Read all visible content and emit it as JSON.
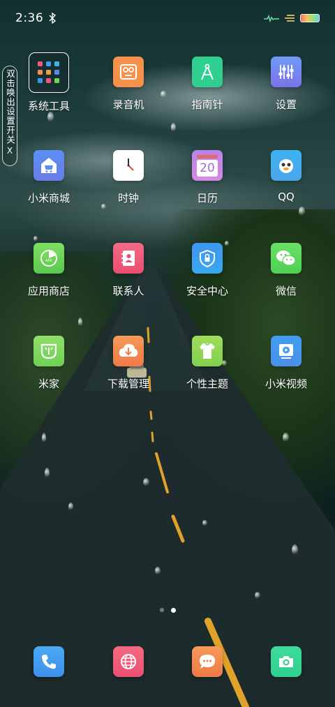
{
  "status_bar": {
    "time": "2:36",
    "bluetooth_icon": "bluetooth-icon",
    "signal_icon": "activity-icon",
    "battery_icon": "battery-icon"
  },
  "side_pill": {
    "text": "双击唤出设置开关",
    "close": "X"
  },
  "apps": [
    {
      "label": "系统工具",
      "icon": "folder-grid-icon",
      "color": "#ffffff"
    },
    {
      "label": "录音机",
      "icon": "tape-recorder-icon",
      "color": "#f5914a"
    },
    {
      "label": "指南针",
      "icon": "compass-icon",
      "color": "#2fcf8f"
    },
    {
      "label": "设置",
      "icon": "sliders-icon",
      "color": "#5c86f0"
    },
    {
      "label": "小米商城",
      "icon": "shop-icon",
      "color": "#5a8ff0"
    },
    {
      "label": "时钟",
      "icon": "clock-icon",
      "color": "#ffffff"
    },
    {
      "label": "日历",
      "icon": "calendar-icon",
      "color": "#b784e8"
    },
    {
      "label": "QQ",
      "icon": "qq-penguin-icon",
      "color": "#3fb2f0"
    },
    {
      "label": "应用商店",
      "icon": "app-store-icon",
      "color": "#6cd55a"
    },
    {
      "label": "联系人",
      "icon": "contacts-icon",
      "color": "#f0577a"
    },
    {
      "label": "安全中心",
      "icon": "shield-icon",
      "color": "#3e96f0"
    },
    {
      "label": "微信",
      "icon": "wechat-icon",
      "color": "#59d357"
    },
    {
      "label": "米家",
      "icon": "mijia-icon",
      "color": "#7fd95c"
    },
    {
      "label": "下载管理",
      "icon": "download-icon",
      "color": "#f58a52"
    },
    {
      "label": "个性主题",
      "icon": "theme-shirt-icon",
      "color": "#8fd650"
    },
    {
      "label": "小米视频",
      "icon": "video-play-icon",
      "color": "#3e9ef0"
    }
  ],
  "calendar_day": "20",
  "page_indicator": {
    "count": 2,
    "active": 2
  },
  "dock": [
    {
      "icon": "phone-icon",
      "color": "#3e9ef0"
    },
    {
      "icon": "browser-globe-icon",
      "color": "#f0577a"
    },
    {
      "icon": "messages-icon",
      "color": "#f58a52"
    },
    {
      "icon": "camera-icon",
      "color": "#2fcf8f"
    }
  ]
}
